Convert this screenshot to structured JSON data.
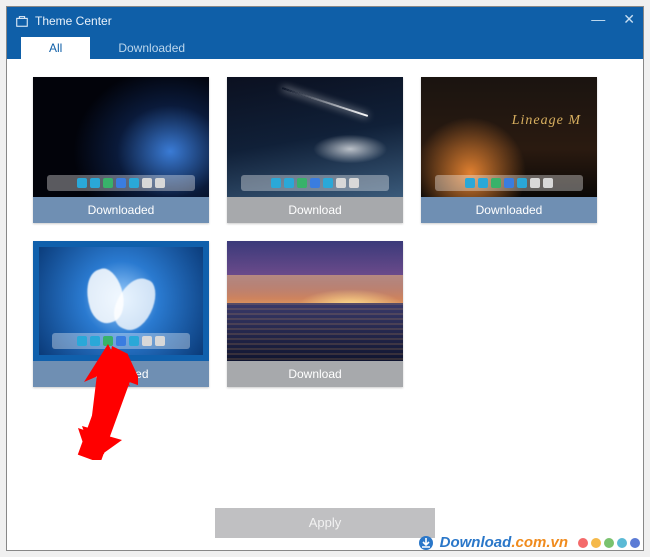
{
  "window": {
    "title": "Theme Center",
    "tabs": [
      {
        "label": "All",
        "active": true
      },
      {
        "label": "Downloaded",
        "active": false
      }
    ]
  },
  "themes": [
    {
      "status": "downloaded",
      "status_label": "Downloaded",
      "thumb": "space",
      "overlay_text": ""
    },
    {
      "status": "download",
      "status_label": "Download",
      "thumb": "meteor",
      "overlay_text": ""
    },
    {
      "status": "downloaded",
      "status_label": "Downloaded",
      "thumb": "lineage",
      "overlay_text": "Lineage M"
    },
    {
      "status": "applied",
      "status_label": "Applied",
      "thumb": "feather",
      "overlay_text": ""
    },
    {
      "status": "download",
      "status_label": "Download",
      "thumb": "sunset",
      "overlay_text": ""
    }
  ],
  "actions": {
    "apply_label": "Apply"
  },
  "watermark": {
    "brand_main": "Download",
    "brand_suffix": ".com.vn",
    "dot_colors": [
      "#f46a6a",
      "#f5b94a",
      "#7ac26e",
      "#5bbad5",
      "#5b7bd5"
    ]
  },
  "dock_icon_colors": [
    "#2aa8d8",
    "#2aa8d8",
    "#38b26a",
    "#3a7de0",
    "#2aa8d8",
    "#d8d8d8",
    "#d8d8d8"
  ]
}
